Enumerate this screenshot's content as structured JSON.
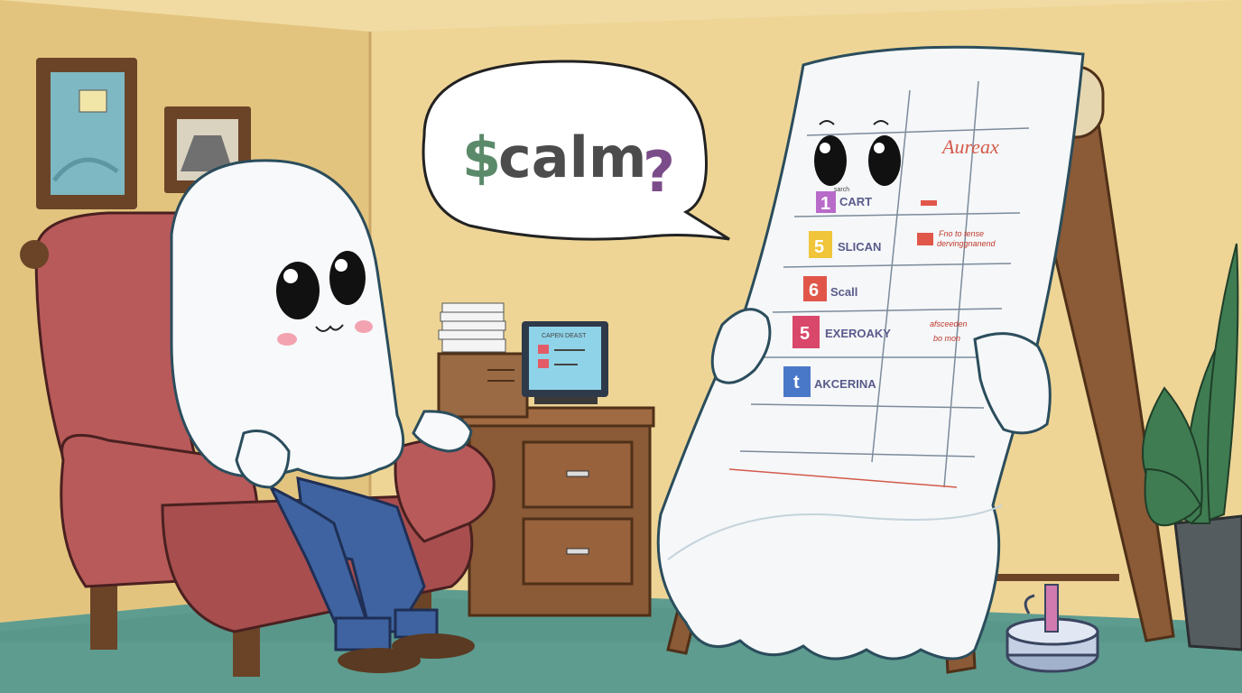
{
  "speech_bubble": {
    "text_dollar": "$",
    "text_word": "calm",
    "text_question": "?"
  },
  "flipchart": {
    "header": "Aureax",
    "rows": [
      {
        "number": "1",
        "label": "CART",
        "color": "#b86bc9"
      },
      {
        "number": "5",
        "label": "SLICAN",
        "color": "#f0c53a"
      },
      {
        "number": "6",
        "label": "Scall",
        "color": "#e0574a"
      },
      {
        "number": "5",
        "label": "EXEROAKY",
        "color": "#d9476a"
      },
      {
        "number": "t",
        "label": "AKCERINA",
        "color": "#4a78c8"
      }
    ],
    "row1_small": "sarch",
    "notes": [
      "Fno to tense",
      "dervinggnanend",
      "afsceeden",
      "bo mon"
    ]
  },
  "monitor": {
    "screen_text": "CAPEN DEAST"
  },
  "colors": {
    "wall": "#ead292",
    "floor": "#5d9a8f",
    "chair": "#b85a5a",
    "ghost": "#f7f9fb",
    "jeans": "#3f63a0",
    "desk": "#8b5a36",
    "plant": "#3f7c52"
  }
}
